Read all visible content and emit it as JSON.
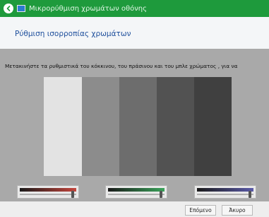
{
  "window": {
    "title": "Μικρορύθμιση χρωμάτων οθόνης"
  },
  "header": {
    "heading": "Ρύθμιση ισορροπίας χρωμάτων"
  },
  "instruction": "Μετακινήστε τα ρυθμιστικά του κόκκινου, του πράσινου και του μπλε χρώματος , για να",
  "swatches": [
    {
      "color": "#e3e3e3"
    },
    {
      "color": "#8c8c8c"
    },
    {
      "color": "#6d6d6d"
    },
    {
      "color": "#525252"
    },
    {
      "color": "#404040"
    }
  ],
  "sliders": [
    {
      "name": "red",
      "color": "#c4453c",
      "value": 0.96
    },
    {
      "name": "green",
      "color": "#3aa35a",
      "value": 0.96
    },
    {
      "name": "blue",
      "color": "#5a5aa8",
      "value": 0.96
    }
  ],
  "buttons": {
    "next": "Επόμενο",
    "cancel": "Άκυρο"
  },
  "icons": {
    "back": "back-arrow-icon",
    "app": "display-color-icon"
  },
  "colors": {
    "titlebar": "#1e9a3c",
    "heading": "#1e4f9c",
    "content_bg": "#a9a9a9"
  }
}
